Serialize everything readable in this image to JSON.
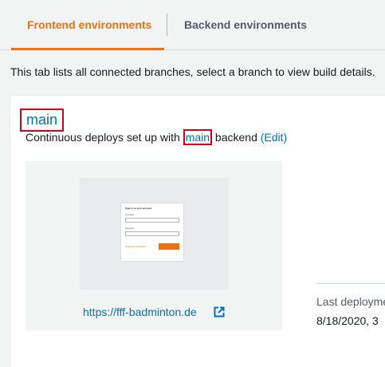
{
  "tabs": [
    {
      "label": "Frontend environments",
      "active": true
    },
    {
      "label": "Backend environments",
      "active": false
    }
  ],
  "description": "This tab lists all connected branches, select a branch to view build details.",
  "branch": {
    "name": "main",
    "subtitle_prefix": "Continuous deploys set up with ",
    "backend_name": "main",
    "subtitle_suffix": " backend ",
    "edit_label": "(Edit)"
  },
  "preview": {
    "form_title": "Sign in to your account",
    "username_label": "Username",
    "password_label": "Password",
    "forgot_label": "Forgot your password?",
    "url": "https://fff-badminton.de"
  },
  "deployment": {
    "label": "Last deployment",
    "value": "8/18/2020, 3"
  },
  "colors": {
    "accent": "#ec7211",
    "link": "#0073bb",
    "highlight": "#d0021b"
  }
}
